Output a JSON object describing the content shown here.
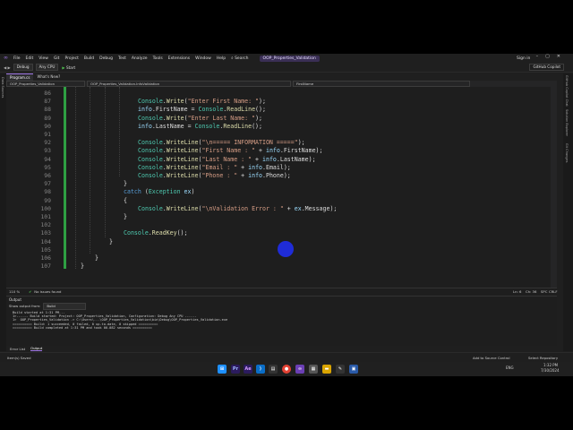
{
  "menu": {
    "items": [
      "File",
      "Edit",
      "View",
      "Git",
      "Project",
      "Build",
      "Debug",
      "Test",
      "Analyze",
      "Tools",
      "Extensions",
      "Window",
      "Help"
    ],
    "search": "Search",
    "solution_title": "OOP_Properties_Validation",
    "sign_in": "Sign in"
  },
  "toolbar": {
    "config": "Debug",
    "platform": "Any CPU",
    "start": "Start",
    "copilot": "GitHub Copilot"
  },
  "tabs": [
    {
      "label": "Program.cs",
      "active": true
    },
    {
      "label": "What's New?",
      "active": false
    }
  ],
  "navbar": {
    "project": "OOP_Properties_Validation",
    "class": "OOP_Properties_Validation.InfoValidation",
    "member": "FirstName"
  },
  "left_rail": {
    "label": "Data Sources"
  },
  "right_rail": {
    "labels": [
      "GitHub Copilot Chat",
      "Solution Explorer",
      "Git Changes"
    ]
  },
  "editor": {
    "lines": [
      {
        "n": "86",
        "text": ""
      },
      {
        "n": "87",
        "text": "Console.Write(\"Enter First Name: \");"
      },
      {
        "n": "88",
        "text": "info.FirstName = Console.ReadLine();"
      },
      {
        "n": "89",
        "text": "Console.Write(\"Enter Last Name: \");"
      },
      {
        "n": "90",
        "text": "info.LastName = Console.ReadLine();"
      },
      {
        "n": "91",
        "text": ""
      },
      {
        "n": "92",
        "text": "Console.WriteLine(\"\\n===== INFORMATION =====\");"
      },
      {
        "n": "93",
        "text": "Console.WriteLine(\"First Name : \" + info.FirstName);"
      },
      {
        "n": "94",
        "text": "Console.WriteLine(\"Last Name : \" + info.LastName);"
      },
      {
        "n": "95",
        "text": "Console.WriteLine(\"Email : \" + info.Email);"
      },
      {
        "n": "96",
        "text": "Console.WriteLine(\"Phone : \" + info.Phone);"
      },
      {
        "n": "97",
        "text": "}"
      },
      {
        "n": "98",
        "text": "catch (Exception ex)"
      },
      {
        "n": "99",
        "text": "{"
      },
      {
        "n": "100",
        "text": "Console.WriteLine(\"\\nValidation Error : \" + ex.Message);"
      },
      {
        "n": "101",
        "text": "}"
      },
      {
        "n": "102",
        "text": ""
      },
      {
        "n": "103",
        "text": "Console.ReadKey();"
      },
      {
        "n": "104",
        "text": "}"
      },
      {
        "n": "105",
        "text": ""
      },
      {
        "n": "106",
        "text": "}"
      },
      {
        "n": "107",
        "text": "}"
      }
    ]
  },
  "editor_status": {
    "zoom": "110 %",
    "issues": "No issues found",
    "ln": "Ln: 6",
    "ch": "Ch: 36",
    "spc": "SPC",
    "crlf": "CRLF"
  },
  "output": {
    "title": "Output",
    "show_from_label": "Show output from:",
    "show_from_value": "Build",
    "log": "Build started at 1:31 PM...\n1>------ Build started: Project: OOP_Properties_Validation, Configuration: Debug Any CPU ------\n1>  OOP_Properties_Validation -> C:\\Users\\...\\OOP_Properties_Validation\\bin\\Debug\\OOP_Properties_Validation.exe\n========== Build: 1 succeeded, 0 failed, 0 up-to-date, 0 skipped ==========\n========== Build completed at 1:31 PM and took 00.082 seconds =========="
  },
  "bottom_tabs": [
    "Error List",
    "Output"
  ],
  "vs_status": {
    "left": "Item(s) Saved",
    "add_source": "Add to Source Control",
    "select_repo": "Select Repository"
  },
  "taskbar": {
    "lang": "ENG",
    "time": "1:32 PM",
    "date": "7/30/2024"
  }
}
